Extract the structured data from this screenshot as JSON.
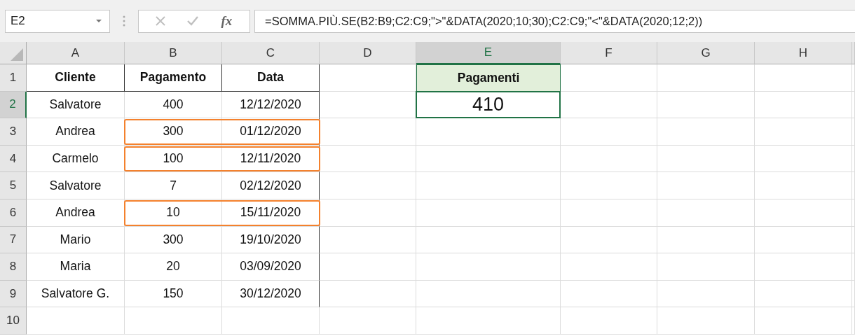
{
  "name_box": {
    "value": "E2"
  },
  "formula_bar": {
    "function_label": "fx",
    "formula": "=SOMMA.PIÙ.SE(B2:B9;C2:C9;\">\"&DATA(2020;10;30);C2:C9;\"<\"&DATA(2020;12;2))"
  },
  "columns": [
    {
      "label": "A",
      "selected": false
    },
    {
      "label": "B",
      "selected": false
    },
    {
      "label": "C",
      "selected": false
    },
    {
      "label": "D",
      "selected": false
    },
    {
      "label": "E",
      "selected": true
    },
    {
      "label": "F",
      "selected": false
    },
    {
      "label": "G",
      "selected": false
    },
    {
      "label": "H",
      "selected": false
    }
  ],
  "row_headers": [
    {
      "label": "1",
      "selected": false
    },
    {
      "label": "2",
      "selected": true
    },
    {
      "label": "3",
      "selected": false
    },
    {
      "label": "4",
      "selected": false
    },
    {
      "label": "5",
      "selected": false
    },
    {
      "label": "6",
      "selected": false
    },
    {
      "label": "7",
      "selected": false
    },
    {
      "label": "8",
      "selected": false
    },
    {
      "label": "9",
      "selected": false
    },
    {
      "label": "10",
      "selected": false
    }
  ],
  "table": {
    "headers": [
      "Cliente",
      "Pagamento",
      "Data"
    ],
    "rows": [
      {
        "cliente": "Salvatore",
        "pagamento": "400",
        "data": "12/12/2020",
        "highlighted": false
      },
      {
        "cliente": "Andrea",
        "pagamento": "300",
        "data": "01/12/2020",
        "highlighted": true
      },
      {
        "cliente": "Carmelo",
        "pagamento": "100",
        "data": "12/11/2020",
        "highlighted": true
      },
      {
        "cliente": "Salvatore",
        "pagamento": "7",
        "data": "02/12/2020",
        "highlighted": false
      },
      {
        "cliente": "Andrea",
        "pagamento": "10",
        "data": "15/11/2020",
        "highlighted": true
      },
      {
        "cliente": "Mario",
        "pagamento": "300",
        "data": "19/10/2020",
        "highlighted": false
      },
      {
        "cliente": "Maria",
        "pagamento": "20",
        "data": "03/09/2020",
        "highlighted": false
      },
      {
        "cliente": "Salvatore G.",
        "pagamento": "150",
        "data": "30/12/2020",
        "highlighted": false
      }
    ]
  },
  "summary": {
    "header": "Pagamenti",
    "value": "410"
  }
}
